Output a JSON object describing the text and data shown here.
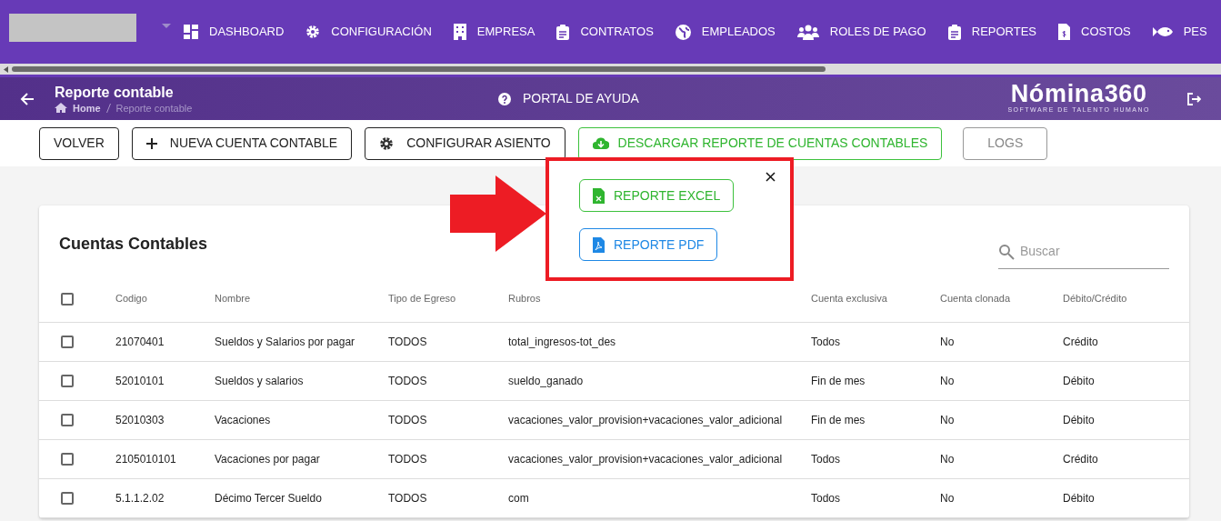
{
  "nav": {
    "items": [
      {
        "label": "DASHBOARD",
        "kind": "dashboard"
      },
      {
        "label": "CONFIGURACIÓN",
        "kind": "gear"
      },
      {
        "label": "EMPRESA",
        "kind": "building"
      },
      {
        "label": "CONTRATOS",
        "kind": "clipboard"
      },
      {
        "label": "EMPLEADOS",
        "kind": "globe"
      },
      {
        "label": "ROLES DE PAGO",
        "kind": "users"
      },
      {
        "label": "REPORTES",
        "kind": "clipboard"
      },
      {
        "label": "COSTOS",
        "kind": "file-dollar"
      },
      {
        "label": "PES",
        "kind": "fish"
      }
    ]
  },
  "header": {
    "title": "Reporte contable",
    "breadcrumb": [
      "Home",
      "Reporte contable"
    ],
    "help": "PORTAL DE AYUDA",
    "logo": {
      "name": "Nómina360",
      "tagline": "SOFTWARE DE TALENTO HUMANO"
    }
  },
  "toolbar": [
    {
      "label": "VOLVER",
      "kind": "plain"
    },
    {
      "label": "NUEVA CUENTA CONTABLE",
      "kind": "plus"
    },
    {
      "label": "CONFIGURAR ASIENTO",
      "kind": "gear"
    },
    {
      "label": "DESCARGAR REPORTE DE CUENTAS CONTABLES",
      "kind": "download"
    },
    {
      "label": "LOGS",
      "kind": "disabled"
    }
  ],
  "download_menu": {
    "items": [
      {
        "label": "REPORTE EXCEL",
        "kind": "excel"
      },
      {
        "label": "REPORTE PDF",
        "kind": "pdf"
      }
    ]
  },
  "card": {
    "title": "Cuentas Contables",
    "search": {
      "placeholder": "Buscar"
    },
    "table": {
      "columns": [
        "Codigo",
        "Nombre",
        "Tipo de Egreso",
        "Rubros",
        "Cuenta exclusiva",
        "Cuenta clonada",
        "Débito/Crédito"
      ],
      "header_checked": false,
      "rows": [
        {
          "checked": false,
          "cells": [
            "21070401",
            "Sueldos y Salarios por pagar",
            "TODOS",
            "total_ingresos-tot_des",
            "Todos",
            "No",
            "Crédito"
          ]
        },
        {
          "checked": false,
          "cells": [
            "52010101",
            "Sueldos y salarios",
            "TODOS",
            "sueldo_ganado",
            "Fin de mes",
            "No",
            "Débito"
          ]
        },
        {
          "checked": false,
          "cells": [
            "52010303",
            "Vacaciones",
            "TODOS",
            "vacaciones_valor_provision+vacaciones_valor_adicional",
            "Fin de mes",
            "No",
            "Débito"
          ]
        },
        {
          "checked": false,
          "cells": [
            "2105010101",
            "Vacaciones por pagar",
            "TODOS",
            "vacaciones_valor_provision+vacaciones_valor_adicional",
            "Todos",
            "No",
            "Crédito"
          ]
        },
        {
          "checked": false,
          "cells": [
            "5.1.1.2.02",
            "Décimo Tercer Sueldo",
            "TODOS",
            "com",
            "Todos",
            "No",
            "Débito"
          ]
        }
      ]
    }
  }
}
